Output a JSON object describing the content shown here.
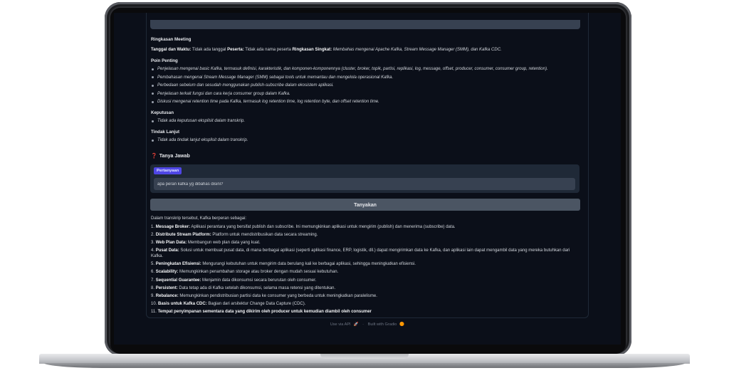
{
  "summary": {
    "heading": "Ringkasan Meeting",
    "meta": {
      "date_label": "Tanggal dan Waktu:",
      "date_value": " Tidak ada tanggal ",
      "participants_label": "Peserta:",
      "participants_value": " Tidak ada nama peserta ",
      "short_label": "Ringkasan Singkat:",
      "short_value": " Membahas mengenai Apache Kafka, Stream Message Manager (SMM), dan Kafka CDC."
    },
    "points_heading": "Poin Penting",
    "points": [
      "Penjelasan mengenai basic Kafka, termasuk definisi, karakteristik, dan komponen-komponennya (cluster, broker, topik, partisi, replikasi, log, message, offset, producer, consumer, consumer group, retention).",
      "Pembahasan mengenai Stream Message Manager (SMM) sebagai tools untuk memantau dan mengelola operasional Kafka.",
      "Perbedaan sebelum dan sesudah menggunakan publish-subscribe dalam ekosistem aplikasi.",
      "Penjelasan terkait fungsi dan cara kerja consumer group dalam Kafka.",
      "Diskusi mengenai retention time pada Kafka, termasuk log retention time, log retention byte, dan offset retention time."
    ],
    "decisions_heading": "Keputusan",
    "decisions": [
      "Tidak ada keputusan eksplisit dalam transkrip."
    ],
    "followup_heading": "Tindak Lanjut",
    "followups": [
      "Tidak ada tindak lanjut eksplisit dalam transkrip."
    ]
  },
  "qa": {
    "icon": "question-mark-icon",
    "icon_glyph": "❓",
    "title": "Tanya Jawab",
    "question_label": "Pertanyaan",
    "question_value": "apa peran kafka yg dibahas disini?",
    "ask_button": "Tanyakan"
  },
  "answer": {
    "intro": "Dalam transkrip tersebut, Kafka berperan sebagai:",
    "items": [
      {
        "num": "1.",
        "term": "Message Broker:",
        "desc": " Aplikasi perantara yang bersifat publish dan subscribe. Ini memungkinkan aplikasi untuk mengirim (publish) dan menerima (subscribe) data."
      },
      {
        "num": "2.",
        "term": "Distribute Stream Platform:",
        "desc": " Platform untuk mendistribusikan data secara streaming."
      },
      {
        "num": "3.",
        "term": "Web Plan Data:",
        "desc": " Membangun web plan data yang kuat."
      },
      {
        "num": "4.",
        "term": "Pusat Data:",
        "desc": " Solusi untuk membuat pusat data, di mana berbagai aplikasi (seperti aplikasi finance, ERP, logistik, dll.) dapat mengirimkan data ke Kafka, dan aplikasi lain dapat mengambil data yang mereka butuhkan dari Kafka."
      },
      {
        "num": "5.",
        "term": "Peningkatan Efisiensi:",
        "desc": " Mengurangi kebutuhan untuk mengirim data berulang kali ke berbagai aplikasi, sehingga meningkatkan efisiensi."
      },
      {
        "num": "6.",
        "term": "Scalability:",
        "desc": " Memungkinkan penambahan storage atau broker dengan mudah sesuai kebutuhan."
      },
      {
        "num": "7.",
        "term": "Sequential Guarantee:",
        "desc": " Menjamin data dikonsumsi secara berurutan oleh consumer."
      },
      {
        "num": "8.",
        "term": "Persistent:",
        "desc": " Data tetap ada di Kafka setelah dikonsumsi, selama masa retensi yang ditentukan."
      },
      {
        "num": "9.",
        "term": "Rebalance:",
        "desc": " Memungkinkan pendistribusian partisi data ke consumer yang berbeda untuk meningkatkan paralelisme."
      },
      {
        "num": "10.",
        "term": "Basis untuk Kafka CDC:",
        "desc": " Bagian dari arsitektur Change Data Capture (CDC)."
      },
      {
        "num": "11.",
        "term": "Tempat penyimpanan sementara data yang dikirim oleh producer untuk kemudian diambil oleh consumer",
        "desc": ""
      }
    ]
  },
  "footer": {
    "api_link": "Use via API",
    "api_icon": "rocket-icon",
    "api_glyph": "🚀",
    "separator": "·",
    "built_with": "Built with Gradio",
    "gradio_icon": "gradio-logo-icon",
    "gradio_glyph": "🟠"
  },
  "colors": {
    "background": "#0b0f19",
    "panel": "#1f2937",
    "input": "#374151",
    "button": "#4b5563",
    "label_badge": "#4f46e5"
  }
}
